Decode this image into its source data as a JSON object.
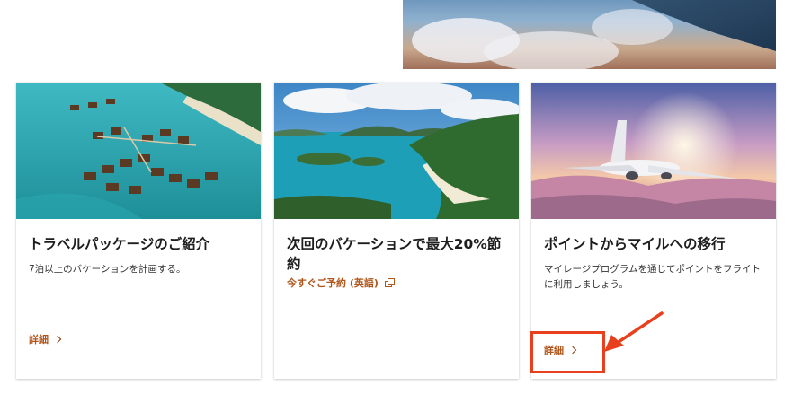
{
  "cards": [
    {
      "title": "トラベルパッケージのご紹介",
      "description": "7泊以上のバケーションを計画する。",
      "link_label": "詳細"
    },
    {
      "title": "次回のバケーションで最大20%節約",
      "link_label": "今すぐご予約 (英語)"
    },
    {
      "title": "ポイントからマイルへの移行",
      "description": "マイレージプログラムを通じてポイントをフライトに利用しましょう。",
      "link_label": "詳細"
    }
  ],
  "colors": {
    "link": "#b0561b",
    "highlight": "#e8401c"
  }
}
